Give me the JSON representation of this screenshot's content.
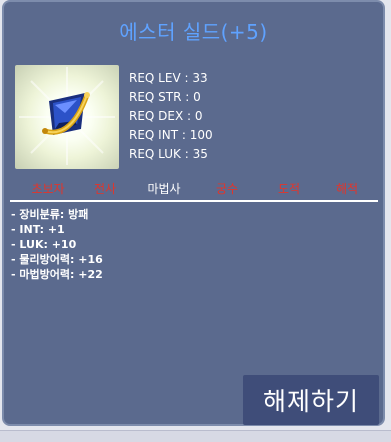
{
  "item": {
    "name": "에스터 실드(+5)",
    "icon": "blue-shield-icon",
    "requirements": [
      "REQ LEV : 33",
      "REQ STR : 0",
      "REQ DEX : 0",
      "REQ INT : 100",
      "REQ LUK : 35"
    ],
    "jobs": [
      {
        "label": "초보자",
        "enabled": false
      },
      {
        "label": "전사",
        "enabled": false
      },
      {
        "label": "마법사",
        "enabled": true
      },
      {
        "label": "궁수",
        "enabled": false
      },
      {
        "label": "도적",
        "enabled": false
      },
      {
        "label": "해적",
        "enabled": false
      }
    ],
    "stats": [
      "- 장비분류: 방패",
      "- INT: +1",
      "- LUK: +10",
      "- 물리방어력: +16",
      "- 마법방어력: +22"
    ]
  },
  "actions": {
    "unlock_label": "해제하기"
  },
  "colors": {
    "panel": "#5b6a8e",
    "title": "#5fa2ff",
    "job_disabled": "#e2352b",
    "job_enabled": "#ffffff",
    "button": "#3f4d79"
  }
}
